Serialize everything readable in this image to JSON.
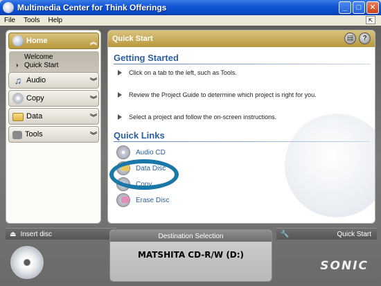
{
  "window": {
    "title": "Multimedia Center for Think Offerings"
  },
  "menu": [
    "File",
    "Tools",
    "Help"
  ],
  "nav": {
    "home": {
      "label": "Home",
      "items": [
        "Welcome",
        "Quick Start"
      ],
      "current": "Quick Start"
    },
    "sections": [
      {
        "label": "Audio",
        "icon": "music-note-icon"
      },
      {
        "label": "Copy",
        "icon": "disc-icon"
      },
      {
        "label": "Data",
        "icon": "folder-icon"
      },
      {
        "label": "Tools",
        "icon": "tools-icon"
      }
    ]
  },
  "main": {
    "header": "Quick Start",
    "getting_started_title": "Getting Started",
    "steps": [
      "Click on a tab to the left, such as Tools.",
      "Review the Project Guide to determine which project is right for you.",
      "Select a project and follow the on-screen instructions."
    ],
    "quick_links_title": "Quick Links",
    "links": [
      "Audio CD",
      "Data Disc",
      "Copy",
      "Erase Disc"
    ]
  },
  "bottom": {
    "insert_label": "Insert disc",
    "destination_label": "Destination Selection",
    "drive": "MATSHITA CD-R/W (D:)",
    "quickstart_label": "Quick Start",
    "brand": "SONIC"
  },
  "colors": {
    "accent_gold": "#c9ad5a",
    "link_blue": "#2a5f9e",
    "highlight_ellipse": "#1a78a8"
  }
}
